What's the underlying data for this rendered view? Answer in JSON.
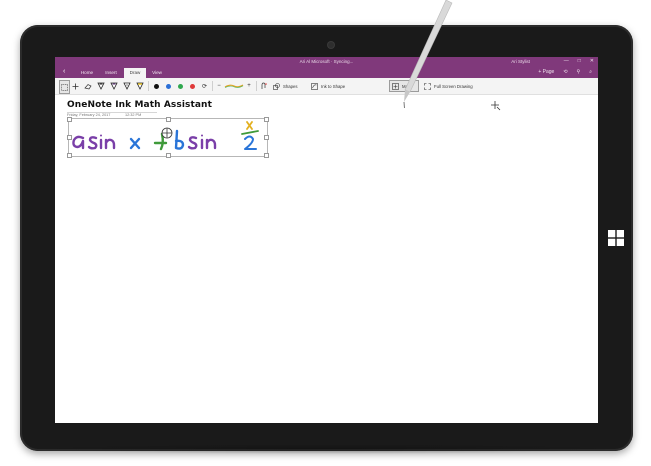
{
  "titlebar": {
    "title": "Ari Al Microsoft · Syncing...",
    "user": "Ari Stylist",
    "controls": [
      "—",
      "□",
      "✕"
    ]
  },
  "tabs": [
    {
      "label": "Home"
    },
    {
      "label": "Insert"
    },
    {
      "label": "Draw"
    },
    {
      "label": "View"
    }
  ],
  "tabrow_right": {
    "add_page": "+ Page",
    "icons": [
      "undo-icon",
      "share-icon",
      "account-icon"
    ]
  },
  "ribbon": {
    "pen_colors": [
      "#111111",
      "#2b6fd6",
      "#2fa84f",
      "#e03a3a"
    ],
    "shapes_label": "Shapes",
    "ink_to_shape_label": "Ink to Shape",
    "math_label": "Math",
    "full_screen_label": "Full Screen Drawing"
  },
  "page": {
    "title": "OneNote Ink Math Assistant",
    "date": "Friday, February 24, 2017",
    "time": "12:32 PM",
    "ink_expression": "a sin x + b sin x/2"
  },
  "colors": {
    "accent": "#80397b",
    "ink_purple": "#7a3fa8",
    "ink_blue": "#2a75d8",
    "ink_green": "#3f9a3a",
    "ink_yellow": "#e3b021"
  }
}
